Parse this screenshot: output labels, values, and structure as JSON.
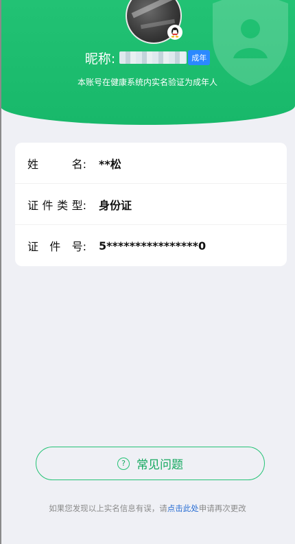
{
  "header": {
    "nickname_label": "昵称:",
    "adult_badge": "成年",
    "verify_text": "本账号在健康系统内实名验证为成年人",
    "avatar_badge_icon": "qq-icon"
  },
  "info": {
    "rows": [
      {
        "label_chars": [
          "姓",
          "名:"
        ],
        "value": "**松"
      },
      {
        "label_chars": [
          "证",
          "件",
          "类",
          "型:"
        ],
        "value": "身份证"
      },
      {
        "label_chars": [
          "证",
          "件",
          "号:"
        ],
        "value": "5****************0"
      }
    ]
  },
  "faq": {
    "button_label": "常见问题",
    "icon": "question-circle-icon"
  },
  "footer": {
    "prefix": "如果您发现以上实名信息有误，请",
    "link": "点击此处",
    "suffix": "申请再次更改"
  },
  "colors": {
    "header_green": "#22c274",
    "accent_blue": "#2b89ff",
    "link_blue": "#2b6fd4",
    "background": "#eff0f5"
  }
}
